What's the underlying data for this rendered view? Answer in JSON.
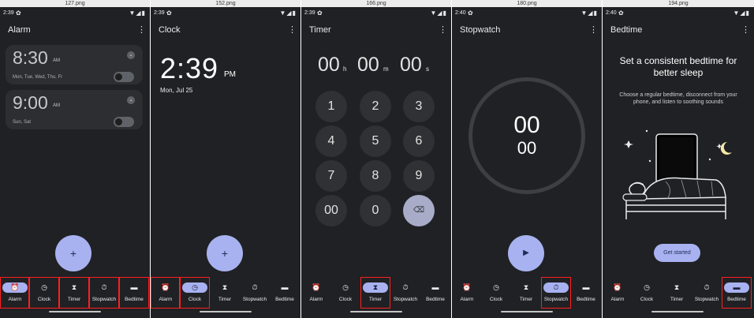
{
  "panels": [
    {
      "file": "127.png",
      "time": "2:39",
      "title": "Alarm"
    },
    {
      "file": "152.png",
      "time": "2:39",
      "title": "Clock"
    },
    {
      "file": "166.png",
      "time": "2:39",
      "title": "Timer"
    },
    {
      "file": "180.png",
      "time": "2:40",
      "title": "Stopwatch"
    },
    {
      "file": "194.png",
      "time": "2:40",
      "title": "Bedtime"
    }
  ],
  "status_icons": {
    "gear": "gear-icon",
    "signal": "▼◢▮"
  },
  "kebab": "⋮",
  "alarm": {
    "alarms": [
      {
        "time": "8:30",
        "ampm": "AM",
        "days": "Mon, Tue, Wed, Thu, Fr",
        "enabled": false
      },
      {
        "time": "9:00",
        "ampm": "AM",
        "days": "Sun, Sat",
        "enabled": false
      }
    ],
    "fab": "+"
  },
  "clock": {
    "time": "2:39",
    "ampm": "PM",
    "date": "Mon, Jul 25",
    "fab": "+"
  },
  "timer": {
    "display": {
      "h": "00",
      "h_unit": "h",
      "m": "00",
      "m_unit": "m",
      "s": "00",
      "s_unit": "s"
    },
    "keys": [
      "1",
      "2",
      "3",
      "4",
      "5",
      "6",
      "7",
      "8",
      "9",
      "00",
      "0",
      "⌫"
    ]
  },
  "stopwatch": {
    "minutes": "00",
    "seconds": "00",
    "play": "▶"
  },
  "bedtime": {
    "heading": "Set a consistent bedtime for better sleep",
    "sub": "Choose a regular bedtime, disconnect from your phone, and listen to soothing sounds",
    "button": "Get started"
  },
  "nav": {
    "items": [
      {
        "label": "Alarm",
        "icon": "⏰"
      },
      {
        "label": "Clock",
        "icon": "◷"
      },
      {
        "label": "Timer",
        "icon": "⧗"
      },
      {
        "label": "Stopwatch",
        "icon": "⏱"
      },
      {
        "label": "Bedtime",
        "icon": "▬"
      }
    ]
  },
  "colors": {
    "background": "#202124",
    "accent": "#a8b2f0",
    "highlight": "#ff1f1f"
  }
}
